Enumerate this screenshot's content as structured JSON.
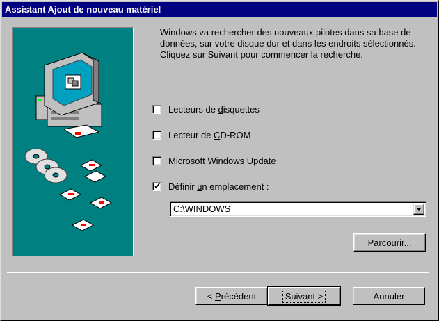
{
  "window": {
    "title": "Assistant Ajout de nouveau matériel"
  },
  "description": "Windows va rechercher des nouveaux pilotes dans sa base de données, sur votre disque dur et dans les endroits sélectionnés. Cliquez sur Suivant pour commencer la recherche.",
  "options": [
    {
      "label_pre": "Lecteurs de ",
      "label_u": "d",
      "label_post": "isquettes",
      "checked": false
    },
    {
      "label_pre": "Lecteur de ",
      "label_u": "C",
      "label_post": "D-ROM",
      "checked": false
    },
    {
      "label_pre": "",
      "label_u": "M",
      "label_post": "icrosoft Windows Update",
      "checked": false
    },
    {
      "label_pre": "Définir ",
      "label_u": "u",
      "label_post": "n emplacement :",
      "checked": true
    }
  ],
  "location": {
    "value": "C:\\WINDOWS"
  },
  "buttons": {
    "browse": {
      "pre": "Pa",
      "u": "r",
      "post": "courir..."
    },
    "back": {
      "pre": "< ",
      "u": "P",
      "post": "récédent"
    },
    "next": "Suivant >",
    "cancel": "Annuler"
  },
  "colors": {
    "title_bg": "#000080",
    "art_bg": "#008080",
    "face": "#c0c0c0"
  }
}
